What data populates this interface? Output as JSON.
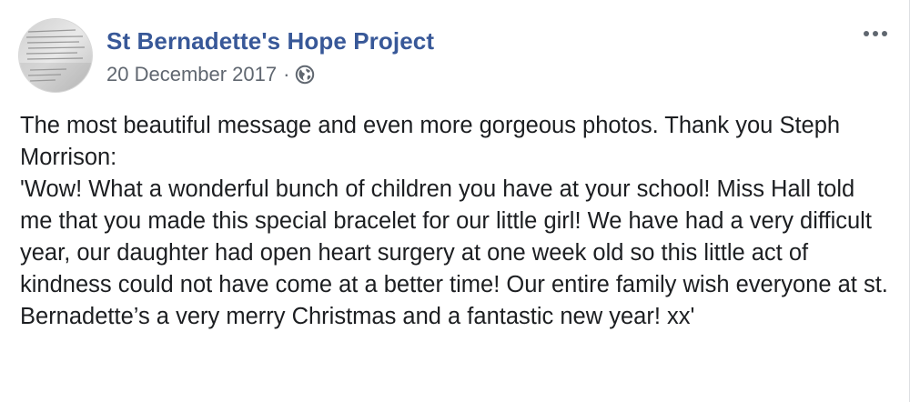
{
  "post": {
    "page_name": "St Bernadette's Hope Project",
    "timestamp": "20 December 2017",
    "separator": "·",
    "privacy_icon": "globe-icon",
    "more_icon": "more-options-icon",
    "text_line1": "The most beautiful message and even more gorgeous photos. Thank you Steph Morrison:",
    "text_quote": "'Wow! What a wonderful bunch of children you have at your school! Miss Hall told me that you made this special bracelet for our little girl! We have had a very difficult year, our daughter had open heart surgery at one week old so this little act of kindness could not have come at a better time! Our entire family wish everyone at st. Bernadette’s a very merry Christmas and a fantastic new year! xx'"
  },
  "colors": {
    "page_name": "#385898",
    "meta": "#606770",
    "text": "#1c1e21"
  }
}
